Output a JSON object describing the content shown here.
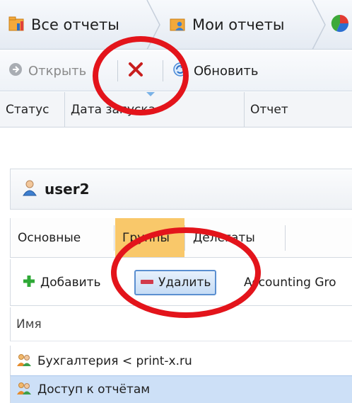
{
  "top": {
    "breadcrumb": {
      "items": [
        {
          "label": "Все отчеты",
          "icon": "folder-chart-icon"
        },
        {
          "label": "Мои отчеты",
          "icon": "user-folder-icon"
        }
      ],
      "overflow_icon": "pie-chart-icon"
    },
    "toolbar": {
      "open_label": "Открыть",
      "open_icon": "arrow-right-circle-icon",
      "delete_icon": "red-x-icon",
      "refresh_label": "Обновить",
      "refresh_icon": "refresh-icon"
    },
    "columns": [
      "Статус",
      "Дата запуска",
      "Отчет"
    ]
  },
  "bottom": {
    "user": {
      "name": "user2",
      "icon": "user-icon"
    },
    "tabs": [
      {
        "label": "Основные",
        "active": false
      },
      {
        "label": "Группы",
        "active": true
      },
      {
        "label": "Делегаты",
        "active": false
      }
    ],
    "toolbar": {
      "add_label": "Добавить",
      "add_icon": "green-plus-icon",
      "delete_label": "Удалить",
      "delete_icon": "red-minus-icon",
      "group_label": "Accounting Gro"
    },
    "list_header": "Имя",
    "rows": [
      {
        "label": "Бухгалтерия < print-x.ru",
        "icon": "group-icon",
        "selected": false
      },
      {
        "label": "Доступ к отчётам",
        "icon": "group-icon",
        "selected": true
      }
    ]
  },
  "colors": {
    "highlight_ring": "#e3141b",
    "active_tab": "#f9c86a",
    "selected_row": "#cde0f7",
    "delete_button_border": "#5b8fd0"
  }
}
